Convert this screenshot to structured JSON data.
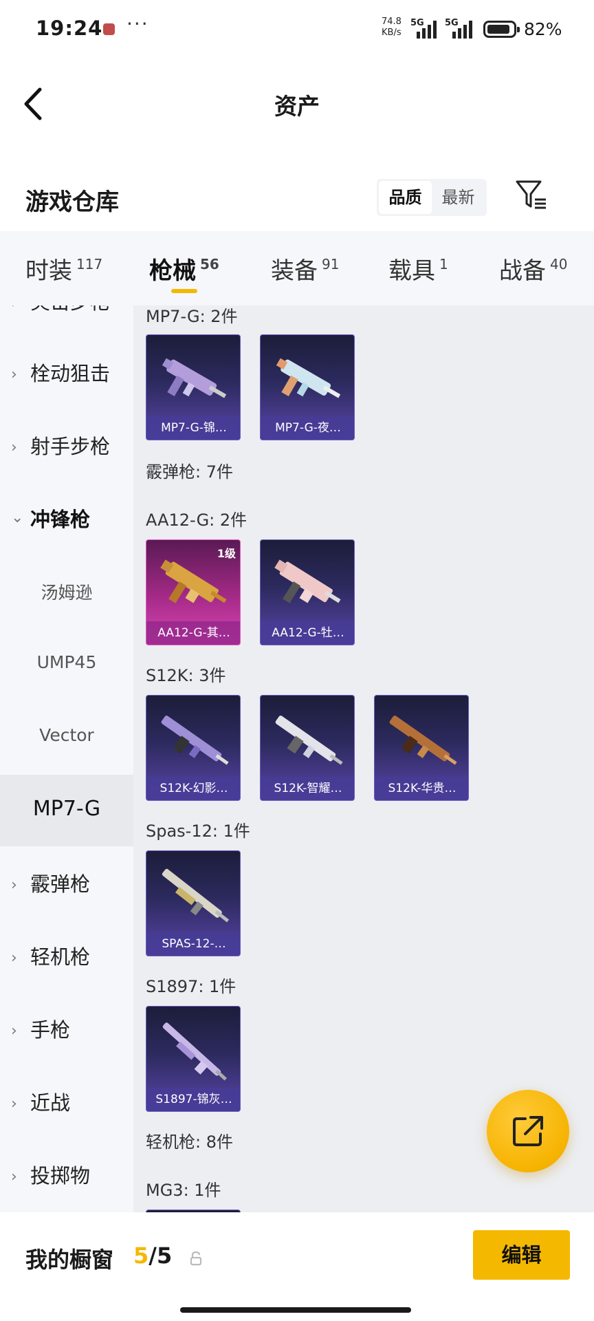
{
  "status": {
    "time": "19:24",
    "speed_value": "74.8",
    "speed_unit": "KB/s",
    "sig1": "5G",
    "sig2": "5G",
    "battery": "82%",
    "icons": [
      "app-notification-icon",
      "more-dots-icon",
      "signal-icon",
      "battery-icon"
    ]
  },
  "header": {
    "title": "资产",
    "back_icon": "back-arrow-icon"
  },
  "warehouse": {
    "title": "游戏仓库",
    "sort_options": [
      "品质",
      "最新"
    ],
    "sort_selected": "品质",
    "filter_icon": "filter-icon"
  },
  "tabs": [
    {
      "label": "时装",
      "count": "117"
    },
    {
      "label": "枪械",
      "count": "56"
    },
    {
      "label": "装备",
      "count": "91"
    },
    {
      "label": "载具",
      "count": "1"
    },
    {
      "label": "战备",
      "count": "40"
    }
  ],
  "active_tab": "枪械",
  "sidebar": {
    "items": [
      "突击步枪",
      "栓动狙击",
      "射手步枪",
      "冲锋枪",
      "汤姆逊",
      "UMP45",
      "Vector",
      "MP7-G",
      "霰弹枪",
      "轻机枪",
      "手枪",
      "近战",
      "投掷物"
    ],
    "selected": "MP7-G"
  },
  "content": {
    "sections": [
      "MP7-G: 2件",
      "霰弹枪: 7件",
      "AA12-G: 2件",
      "S12K: 3件",
      "Spas-12: 1件",
      "S1897: 1件",
      "轻机枪: 8件",
      "MG3: 1件"
    ],
    "cards": [
      "MP7-G-锦…",
      "MP7-G-夜…",
      "AA12-G-其…",
      "AA12-G-牡…",
      "S12K-幻影…",
      "S12K-智耀…",
      "S12K-华贵…",
      "SPAS-12-…",
      "S1897-锦灰…"
    ],
    "aa12_level": "1级"
  },
  "fab": {
    "icon": "share-external-icon"
  },
  "bottom": {
    "label": "我的橱窗",
    "current": "5",
    "separator": "/",
    "total": "5",
    "lock_icon": "lock-icon",
    "edit_label": "编辑"
  },
  "colors": {
    "accent": "#f5b800",
    "card_blue": "#5a45a8",
    "card_pink": "#d748b4",
    "panel": "#f6f7fa"
  }
}
